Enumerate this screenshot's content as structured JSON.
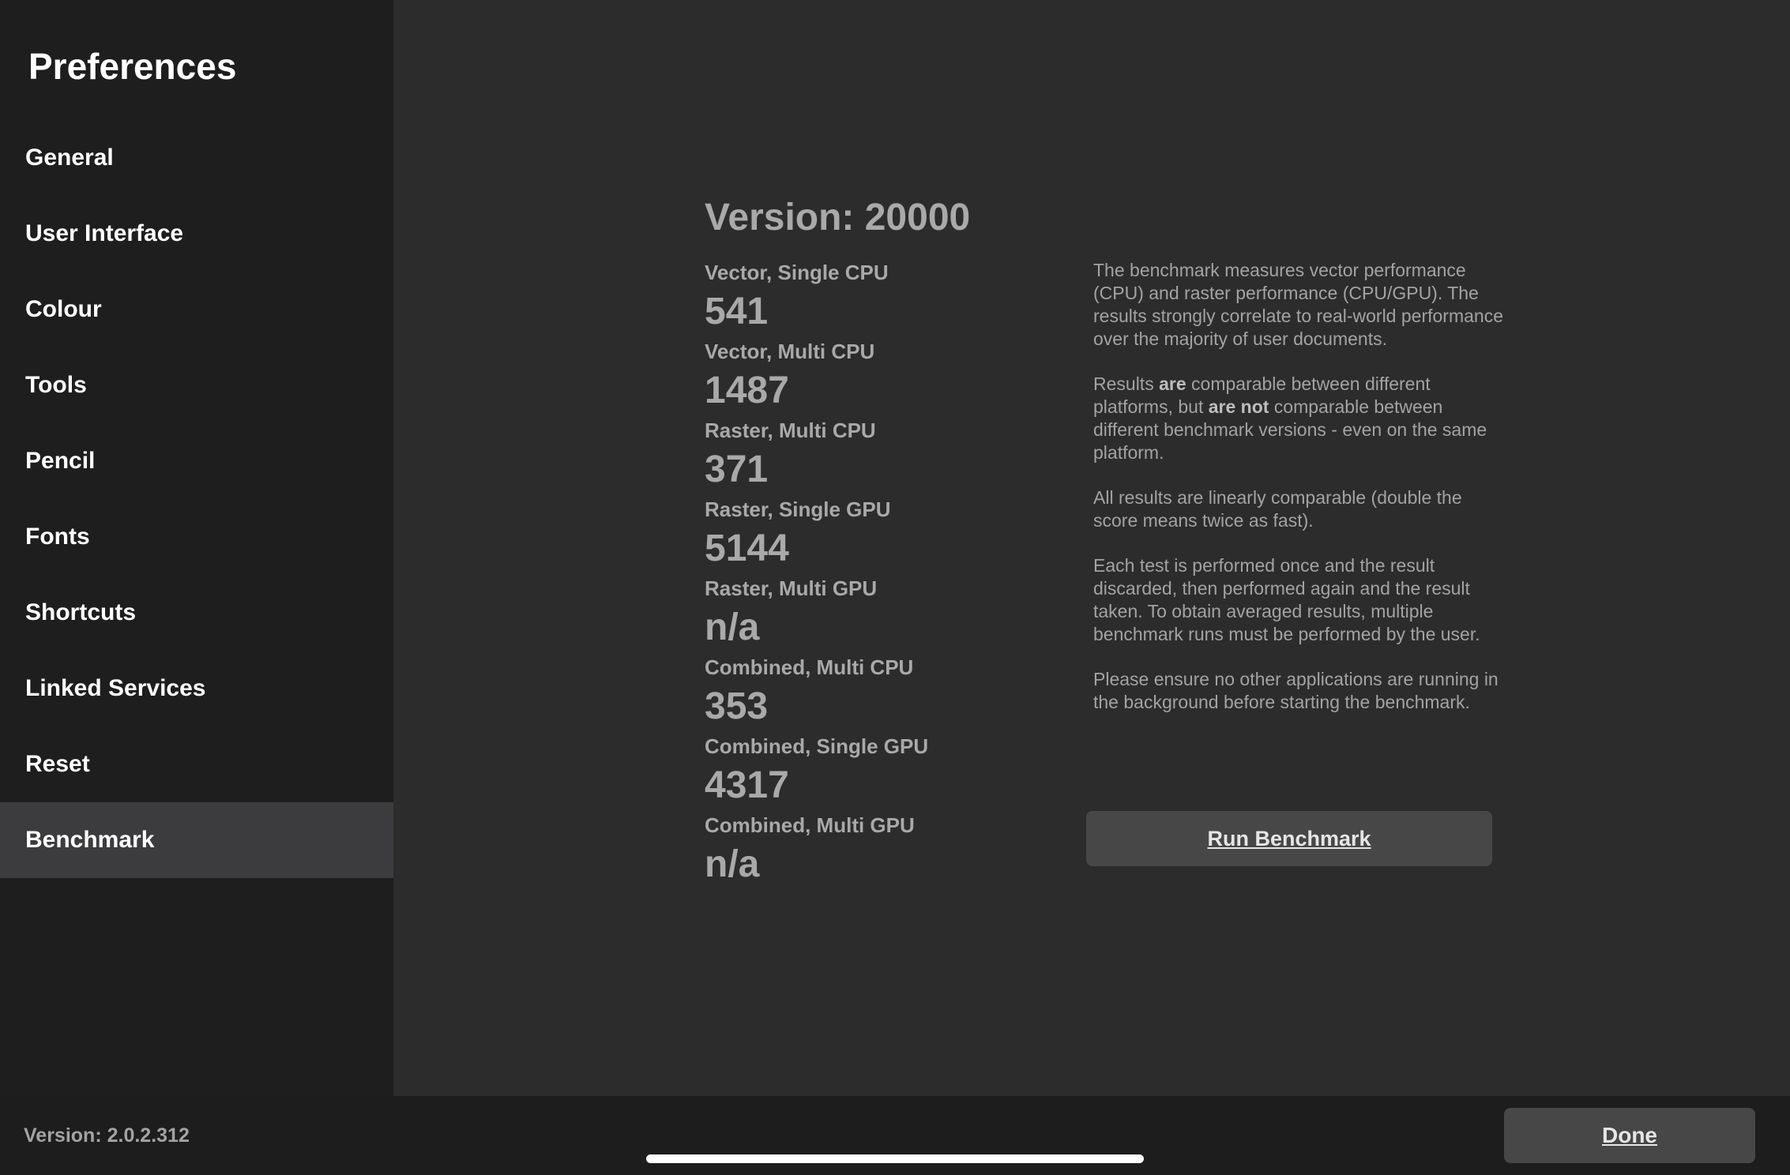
{
  "sidebar": {
    "title": "Preferences",
    "items": [
      {
        "label": "General"
      },
      {
        "label": "User Interface"
      },
      {
        "label": "Colour"
      },
      {
        "label": "Tools"
      },
      {
        "label": "Pencil"
      },
      {
        "label": "Fonts"
      },
      {
        "label": "Shortcuts"
      },
      {
        "label": "Linked Services"
      },
      {
        "label": "Reset"
      },
      {
        "label": "Benchmark"
      }
    ],
    "selected": "Benchmark"
  },
  "benchmark": {
    "version_heading": "Version: 20000",
    "results": [
      {
        "label": "Vector, Single CPU",
        "value": "541"
      },
      {
        "label": "Vector, Multi CPU",
        "value": "1487"
      },
      {
        "label": "Raster, Multi CPU",
        "value": "371"
      },
      {
        "label": "Raster, Single GPU",
        "value": "5144"
      },
      {
        "label": "Raster, Multi GPU",
        "value": "n/a"
      },
      {
        "label": "Combined, Multi CPU",
        "value": "353"
      },
      {
        "label": "Combined, Single GPU",
        "value": "4317"
      },
      {
        "label": "Combined, Multi GPU",
        "value": "n/a"
      }
    ],
    "description": {
      "p1": "The benchmark measures vector performance (CPU) and raster performance (CPU/GPU). The results strongly correlate to real-world performance over the majority of user documents.",
      "p2_a": "Results ",
      "p2_b": "are",
      "p2_c": " comparable between different platforms, but ",
      "p2_d": "are not",
      "p2_e": " comparable between different benchmark versions - even on the same platform.",
      "p3": "All results are linearly comparable (double the score means twice as fast).",
      "p4": "Each test is performed once and the result discarded, then performed again and the result taken. To obtain averaged results, multiple benchmark runs must be performed by the user.",
      "p5": "Please ensure no other applications are running in the background before starting the benchmark."
    },
    "run_button_label": "Run Benchmark"
  },
  "footer": {
    "app_version": "Version: 2.0.2.312",
    "done_label": "Done"
  },
  "colors": {
    "sidebar_bg": "#1e1e1e",
    "main_bg": "#2c2c2c",
    "selected_bg": "#3c3c3e",
    "button_bg": "#474747"
  }
}
